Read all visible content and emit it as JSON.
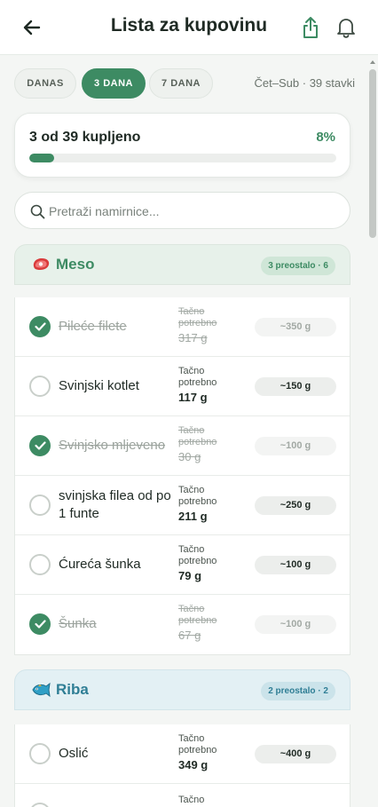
{
  "header": {
    "title": "Lista za kupovinu"
  },
  "range": {
    "options": [
      "DANAS",
      "3 DANA",
      "7 DANA"
    ],
    "selected": "3 DANA",
    "summary": "Čet–Sub · 39 stavki"
  },
  "progress": {
    "text": "3 od 39 kupljeno",
    "percent_label": "8%",
    "fraction": 0.08
  },
  "search": {
    "placeholder": "Pretraži namirnice..."
  },
  "categories": [
    {
      "name": "Meso",
      "icon": "meat-icon",
      "badge": "3 preostalo · 6",
      "items": [
        {
          "name": "Pileće filete",
          "need_label": "Tačno potrebno",
          "need_amount": "317 g",
          "qty": "~350 g",
          "bought": true
        },
        {
          "name": "Svinjski kotlet",
          "need_label": "Tačno potrebno",
          "need_amount": "117 g",
          "qty": "~150 g",
          "bought": false
        },
        {
          "name": "Svinjsko mljeveno",
          "need_label": "Tačno potrebno",
          "need_amount": "30 g",
          "qty": "~100 g",
          "bought": true
        },
        {
          "name": "svinjska filea od po 1 funte",
          "need_label": "Tačno potrebno",
          "need_amount": "211 g",
          "qty": "~250 g",
          "bought": false
        },
        {
          "name": "Ćureća šunka",
          "need_label": "Tačno potrebno",
          "need_amount": "79 g",
          "qty": "~100 g",
          "bought": false
        },
        {
          "name": "Šunka",
          "need_label": "Tačno potrebno",
          "need_amount": "67 g",
          "qty": "~100 g",
          "bought": true
        }
      ]
    },
    {
      "name": "Riba",
      "icon": "fish-icon",
      "badge": "2 preostalo · 2",
      "items": [
        {
          "name": "Oslić",
          "need_label": "Tačno potrebno",
          "need_amount": "349 g",
          "qty": "~400 g",
          "bought": false
        },
        {
          "name": "",
          "need_label": "Tačno",
          "need_amount": "",
          "qty": "",
          "bought": false
        }
      ]
    }
  ],
  "colors": {
    "accent": "#3d8b63",
    "fish_accent": "#2f7e95",
    "background": "#f4f6f4"
  }
}
